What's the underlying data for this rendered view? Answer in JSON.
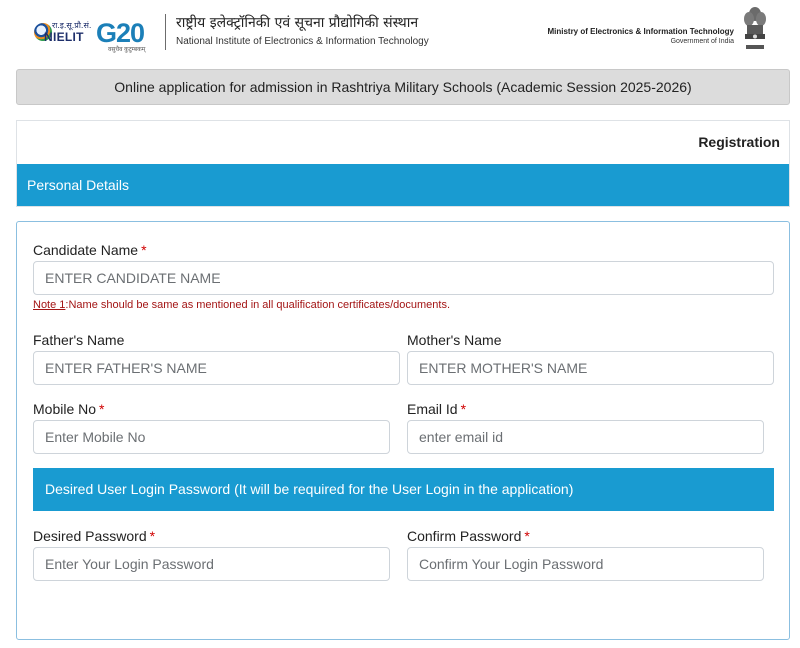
{
  "header": {
    "nielit_hindi": "रा.इ.सू.प्रौ.सं.",
    "nielit_text": "NIELIT",
    "g20_text": "G20",
    "g20_sub": "वसुधैव कुटुम्बकम्",
    "institute_hindi": "राष्ट्रीय इलेक्ट्रॉनिकी एवं सूचना प्रौद्योगिकी संस्थान",
    "institute_english": "National Institute of Electronics & Information Technology",
    "ministry": "Ministry of Electronics & Information Technology",
    "government": "Government of India"
  },
  "app_title": "Online application for admission in Rashtriya Military Schools (Academic Session 2025-2026)",
  "registration_label": "Registration",
  "section_personal": "Personal Details",
  "form": {
    "candidate_name": {
      "label": "Candidate Name",
      "required_mark": "*",
      "placeholder": "ENTER CANDIDATE NAME"
    },
    "note_label": "Note 1",
    "note_text": ":Name should be same as mentioned in all qualification certificates/documents.",
    "father_name": {
      "label": "Father's Name",
      "placeholder": "ENTER FATHER'S NAME"
    },
    "mother_name": {
      "label": "Mother's Name",
      "placeholder": "ENTER MOTHER'S NAME"
    },
    "mobile": {
      "label": "Mobile No",
      "required_mark": "*",
      "placeholder": "Enter Mobile No"
    },
    "email": {
      "label": "Email Id",
      "required_mark": "*",
      "placeholder": "enter email id"
    },
    "password_section": "Desired User Login Password (It will be required for the User Login in the application)",
    "desired_password": {
      "label": "Desired Password",
      "required_mark": "*",
      "placeholder": "Enter Your Login Password"
    },
    "confirm_password": {
      "label": "Confirm Password",
      "required_mark": "*",
      "placeholder": "Confirm Your Login Password"
    }
  },
  "colors": {
    "section_bar": "#199bd1",
    "required": "#d00000",
    "note": "#a31515"
  }
}
